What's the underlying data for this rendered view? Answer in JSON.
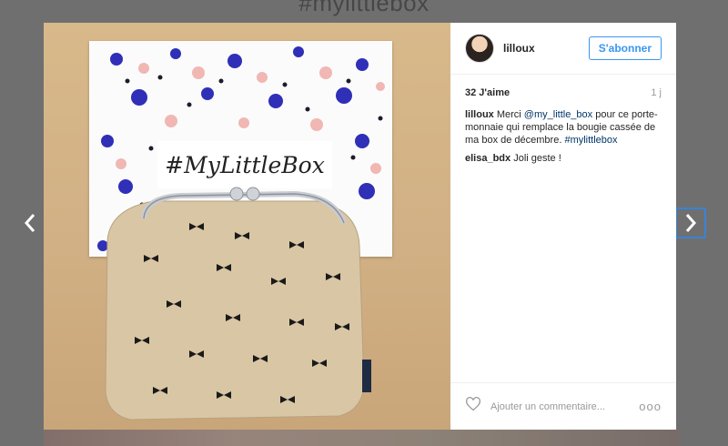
{
  "background": {
    "hashtag_title": "#mylittlebox"
  },
  "photo": {
    "card_text": "#MyLittleBox"
  },
  "post": {
    "username": "lilloux",
    "follow_label": "S'abonner",
    "likes": "32 J'aime",
    "age": "1 j",
    "caption": {
      "user": "lilloux",
      "text_before": "Merci ",
      "mention": "@my_little_box",
      "text_after": " pour ce porte-monnaie qui remplace la bougie cassée de ma box de décembre. ",
      "hashtag": "#mylittlebox"
    },
    "comments": [
      {
        "user": "elisa_bdx",
        "text": "Joli geste !"
      }
    ],
    "comment_placeholder": "Ajouter un commentaire...",
    "more_label": "ooo"
  },
  "colors": {
    "accent": "#3897f0",
    "link": "#003569",
    "nav_focus": "#3b82d6"
  }
}
